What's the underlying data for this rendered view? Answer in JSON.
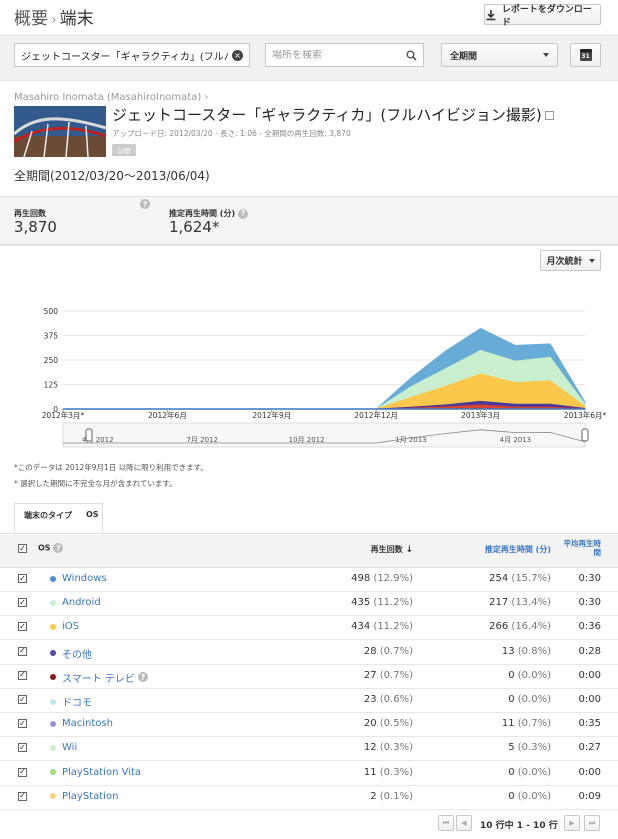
{
  "breadcrumb": {
    "parent": "概要",
    "separator": "›",
    "current": "端末"
  },
  "download_button": {
    "label": "レポートをダウンロード",
    "icon": "download-icon"
  },
  "filters": {
    "video_value": "ジェットコースター「ギャラクティカ」(フルハイビジョ",
    "location_placeholder": "場所を検索",
    "period": "全期間",
    "calendar_icon_text": "31"
  },
  "video": {
    "channel": "Masahiro Inomata (MasahiroInomata) ›",
    "title": "ジェットコースター「ギャラクティカ」(フルハイビジョン撮影)",
    "meta": "アップロード日: 2012/03/20 - 長さ: 1:06 - 全期間の再生回数: 3,870",
    "tag": "公開",
    "period_label": "全期間(2012/03/20〜2013/06/04)"
  },
  "stats": {
    "views_label": "再生回数",
    "views_value": "3,870",
    "watch_label": "推定再生時間 (分)",
    "watch_value": "1,624*",
    "help": "?"
  },
  "chart_controls": {
    "granularity": "月次統計"
  },
  "chart_data": {
    "type": "area",
    "x": [
      "2012-03",
      "2012-04",
      "2012-05",
      "2012-06",
      "2012-07",
      "2012-08",
      "2012-09",
      "2012-10",
      "2012-11",
      "2012-12",
      "2013-01",
      "2013-02",
      "2013-03",
      "2013-04",
      "2013-05",
      "2013-06"
    ],
    "stacked": true,
    "ylim": [
      0,
      500
    ],
    "yticks": [
      "500",
      "375",
      "250",
      "125",
      "0"
    ],
    "xticks": [
      {
        "label": "2012年3月*",
        "index": 0
      },
      {
        "label": "2012年6月",
        "index": 3
      },
      {
        "label": "2012年9月",
        "index": 6
      },
      {
        "label": "2012年12月",
        "index": 9
      },
      {
        "label": "2013年3月",
        "index": 12
      },
      {
        "label": "2013年6月*",
        "index": 15
      }
    ],
    "series": [
      {
        "color": "#d83b2a",
        "values": [
          0,
          0,
          0,
          0,
          0,
          0,
          0,
          0,
          0,
          0,
          5,
          12,
          22,
          10,
          10,
          2
        ]
      },
      {
        "color": "#3f2f97",
        "values": [
          0,
          0,
          0,
          0,
          0,
          0,
          0,
          0,
          0,
          0,
          5,
          10,
          18,
          15,
          15,
          2
        ]
      },
      {
        "color": "#fcc642",
        "values": [
          0,
          0,
          0,
          0,
          0,
          0,
          0,
          0,
          0,
          0,
          50,
          95,
          140,
          110,
          120,
          10
        ]
      },
      {
        "color": "#c8efcc",
        "values": [
          0,
          0,
          0,
          0,
          0,
          0,
          0,
          0,
          0,
          0,
          55,
          90,
          120,
          110,
          120,
          12
        ]
      },
      {
        "color": "#5ea8d5",
        "values": [
          0,
          0,
          0,
          0,
          0,
          0,
          0,
          0,
          0,
          0,
          45,
          90,
          112,
          80,
          68,
          10
        ]
      }
    ],
    "navigator_labels": [
      "4月 2012",
      "7月 2012",
      "10月 2012",
      "1月 2013",
      "4月 2013"
    ]
  },
  "notes": {
    "note1": "*このデータは 2012年9月1日 以降に限り利用できます。",
    "note2": "* 選択した期間に不完全な月が含まれています。"
  },
  "tabs": {
    "type_label": "端末のタイプ",
    "os_label": "OS"
  },
  "table": {
    "col_os": "OS",
    "col_views": "再生回数",
    "col_watch": "推定再生時間 (分)",
    "col_avg": "平均再生時間",
    "rows": [
      {
        "name": "Windows",
        "color": "#4a90d6",
        "views": "498",
        "views_pct": "(12.9%)",
        "watch": "254",
        "watch_pct": "(15.7%)",
        "avg": "0:30",
        "help": false
      },
      {
        "name": "Android",
        "color": "#c8efcc",
        "views": "435",
        "views_pct": "(11.2%)",
        "watch": "217",
        "watch_pct": "(13.4%)",
        "avg": "0:30",
        "help": false
      },
      {
        "name": "iOS",
        "color": "#fcc642",
        "views": "434",
        "views_pct": "(11.2%)",
        "watch": "266",
        "watch_pct": "(16.4%)",
        "avg": "0:36",
        "help": false
      },
      {
        "name": "その他",
        "color": "#5b46a8",
        "views": "28",
        "views_pct": "(0.7%)",
        "watch": "13",
        "watch_pct": "(0.8%)",
        "avg": "0:28",
        "help": false
      },
      {
        "name": "スマート テレビ",
        "color": "#8b1a1a",
        "views": "27",
        "views_pct": "(0.7%)",
        "watch": "0",
        "watch_pct": "(0.0%)",
        "avg": "0:00",
        "help": true
      },
      {
        "name": "ドコモ",
        "color": "#bfe6e6",
        "views": "23",
        "views_pct": "(0.6%)",
        "watch": "0",
        "watch_pct": "(0.0%)",
        "avg": "0:00",
        "help": false
      },
      {
        "name": "Macintosh",
        "color": "#9a95d6",
        "views": "20",
        "views_pct": "(0.5%)",
        "watch": "11",
        "watch_pct": "(0.7%)",
        "avg": "0:35",
        "help": false
      },
      {
        "name": "Wii",
        "color": "#d6ecd2",
        "views": "12",
        "views_pct": "(0.3%)",
        "watch": "5",
        "watch_pct": "(0.3%)",
        "avg": "0:27",
        "help": false
      },
      {
        "name": "PlayStation Vita",
        "color": "#9ee07a",
        "views": "11",
        "views_pct": "(0.3%)",
        "watch": "0",
        "watch_pct": "(0.0%)",
        "avg": "0:00",
        "help": false
      },
      {
        "name": "PlayStation",
        "color": "#f5d37a",
        "views": "2",
        "views_pct": "(0.1%)",
        "watch": "0",
        "watch_pct": "(0.0%)",
        "avg": "0:09",
        "help": false
      }
    ]
  },
  "pagination": {
    "label": "10 行中 1 - 10 行",
    "first": "⏮",
    "prev": "◀",
    "next": "▶",
    "last": "⏭"
  }
}
